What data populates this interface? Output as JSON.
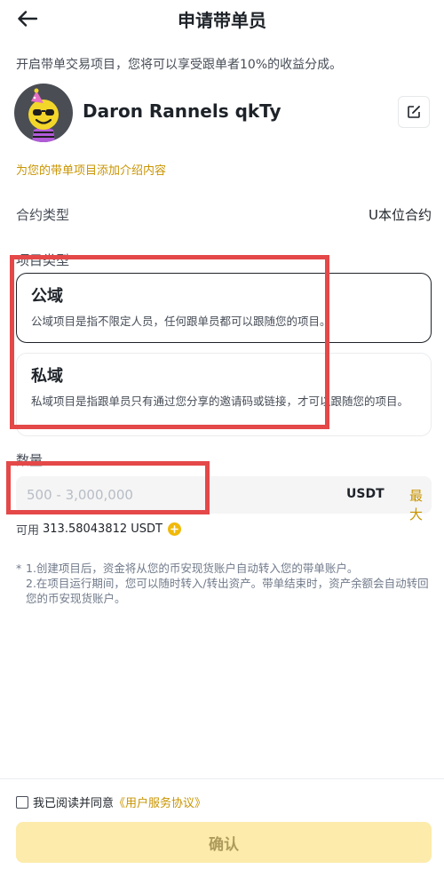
{
  "header": {
    "title": "申请带单员",
    "back_icon": "arrow-left-icon"
  },
  "intro": "开启带单交易项目，您将可以享受跟单者10%的收益分成。",
  "profile": {
    "name": "Daron Rannels qkTy",
    "edit_icon": "edit-icon"
  },
  "add_intro_link": "为您的带单项目添加介绍内容",
  "contract": {
    "label": "合约类型",
    "value": "U本位合约"
  },
  "project_type": {
    "label": "项目类型",
    "options": [
      {
        "name": "公域",
        "desc": "公域项目是指不限定人员，任何跟单员都可以跟随您的项目。",
        "selected": true
      },
      {
        "name": "私域",
        "desc": "私域项目是指跟单员只有通过您分享的邀请码或链接，才可以跟随您的项目。",
        "selected": false
      }
    ]
  },
  "amount": {
    "label": "数量",
    "placeholder": "500 - 3,000,000",
    "value": "",
    "unit": "USDT",
    "max_label": "最大",
    "available_label": "可用",
    "available_value": "313.58043812 USDT"
  },
  "notes": {
    "bullet": "*",
    "lines": [
      "1.创建项目后，资金将从您的币安现货账户自动转入您的带单账户。",
      "2.在项目运行期间，您可以随时转入/转出资产。带单结束时，资产余额会自动转回您的币安现货账户。"
    ]
  },
  "agreement": {
    "text": "我已阅读并同意",
    "link": "《用户服务协议》",
    "checked": false
  },
  "confirm_button": "确认",
  "colors": {
    "accent": "#c99400",
    "brand_yellow": "#f0b90b",
    "confirm_disabled_bg": "#fcebab",
    "highlight_red": "#e44848"
  }
}
